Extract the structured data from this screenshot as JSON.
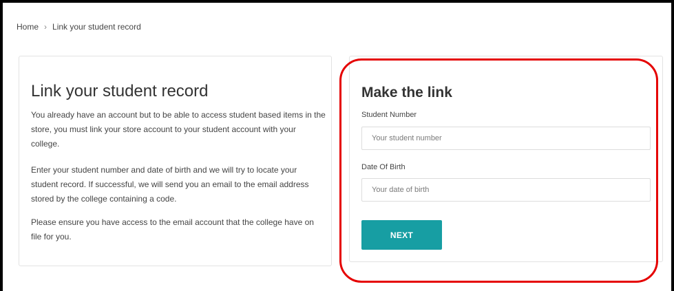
{
  "breadcrumb": {
    "home": "Home",
    "separator": "›",
    "current": "Link your student record"
  },
  "info_card": {
    "title": "Link your student record",
    "paragraphs": [
      "You already have an account but to be able to access student based items in the store, you must link your store account to your student account with your college.",
      "Enter your student number and date of birth and we will try to locate your student record. If successful, we will send you an email to the email address stored by the college containing a code.",
      "Please ensure you have access to the email account that the college have on file for you."
    ]
  },
  "link_form": {
    "title": "Make the link",
    "student_number_label": "Student Number",
    "student_number_placeholder": "Your student number",
    "student_number_value": "",
    "dob_label": "Date Of Birth",
    "dob_placeholder": "Your date of birth",
    "dob_value": "",
    "next_label": "NEXT"
  },
  "colors": {
    "accent": "#179ea3",
    "highlight": "#e50000",
    "frame": "#000000"
  }
}
